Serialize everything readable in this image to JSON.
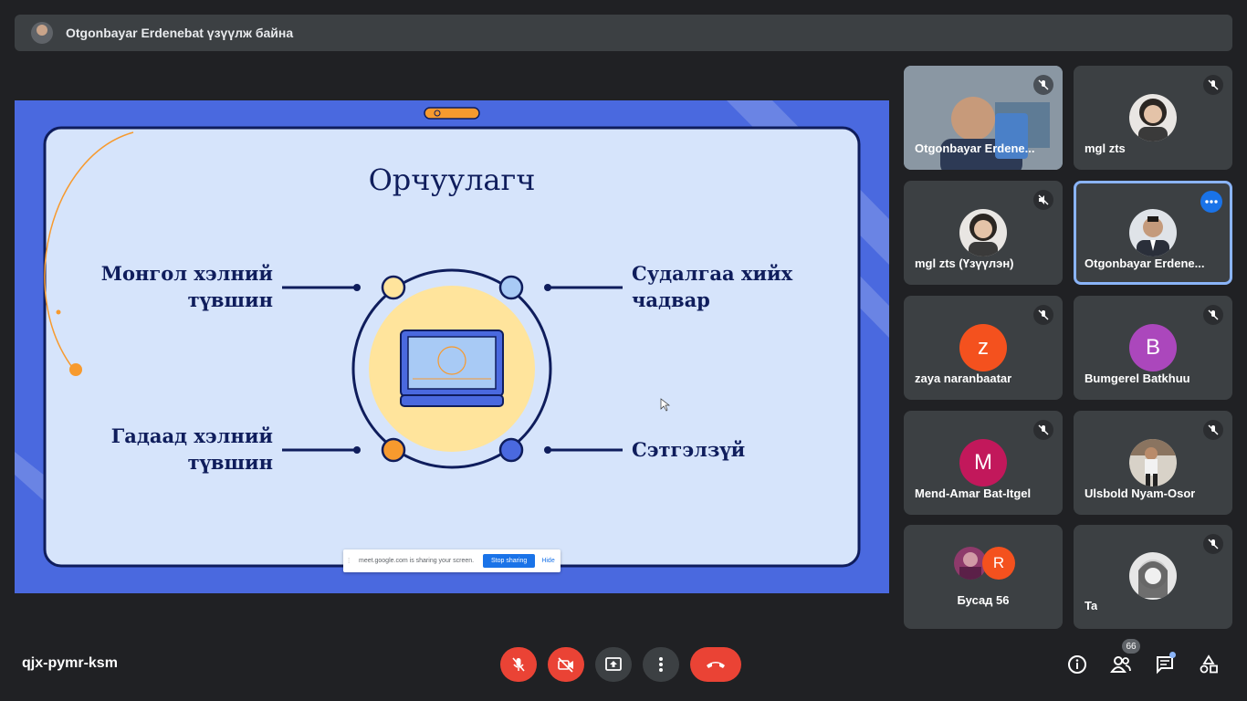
{
  "banner": {
    "text": "Otgonbayar Erdenebat үзүүлж байна"
  },
  "slide": {
    "title": "Орчуулагч",
    "left_top": [
      "Монгол хэлний",
      "түвшин"
    ],
    "right_top": [
      "Судалгаа хийх",
      "чадвар"
    ],
    "left_bottom": [
      "Гадаад хэлний",
      "түвшин"
    ],
    "right_bottom": [
      "Сэтгэлзүй"
    ]
  },
  "share_bar": {
    "message": "meet.google.com is sharing your screen.",
    "stop_label": "Stop sharing",
    "hide_label": "Hide"
  },
  "participants": [
    {
      "name": "Otgonbayar Erdene...",
      "type": "video"
    },
    {
      "name": "mgl zts",
      "type": "photo"
    },
    {
      "name": "mgl zts (Үзүүлэн)",
      "type": "photo"
    },
    {
      "name": "Otgonbayar Erdene...",
      "type": "photo"
    },
    {
      "name": "zaya naranbaatar",
      "type": "letter",
      "letter": "z",
      "color": "#f4511e"
    },
    {
      "name": "Bumgerel Batkhuu",
      "type": "letter",
      "letter": "B",
      "color": "#ab47bc"
    },
    {
      "name": "Mend-Amar Bat-Itgel",
      "type": "letter",
      "letter": "M",
      "color": "#c2185b"
    },
    {
      "name": "Ulsbold Nyam-Osor",
      "type": "photo"
    },
    {
      "name": "Бусад 56",
      "type": "others",
      "letter": "R",
      "color": "#f4511e"
    },
    {
      "name": "Ta",
      "type": "photo"
    }
  ],
  "meeting_code": "qjx-pymr-ksm",
  "people_count": "66",
  "colors": {
    "end_call": "#ea4335",
    "slide_bg": "#4a69df",
    "active_border": "#8ab4f8"
  }
}
